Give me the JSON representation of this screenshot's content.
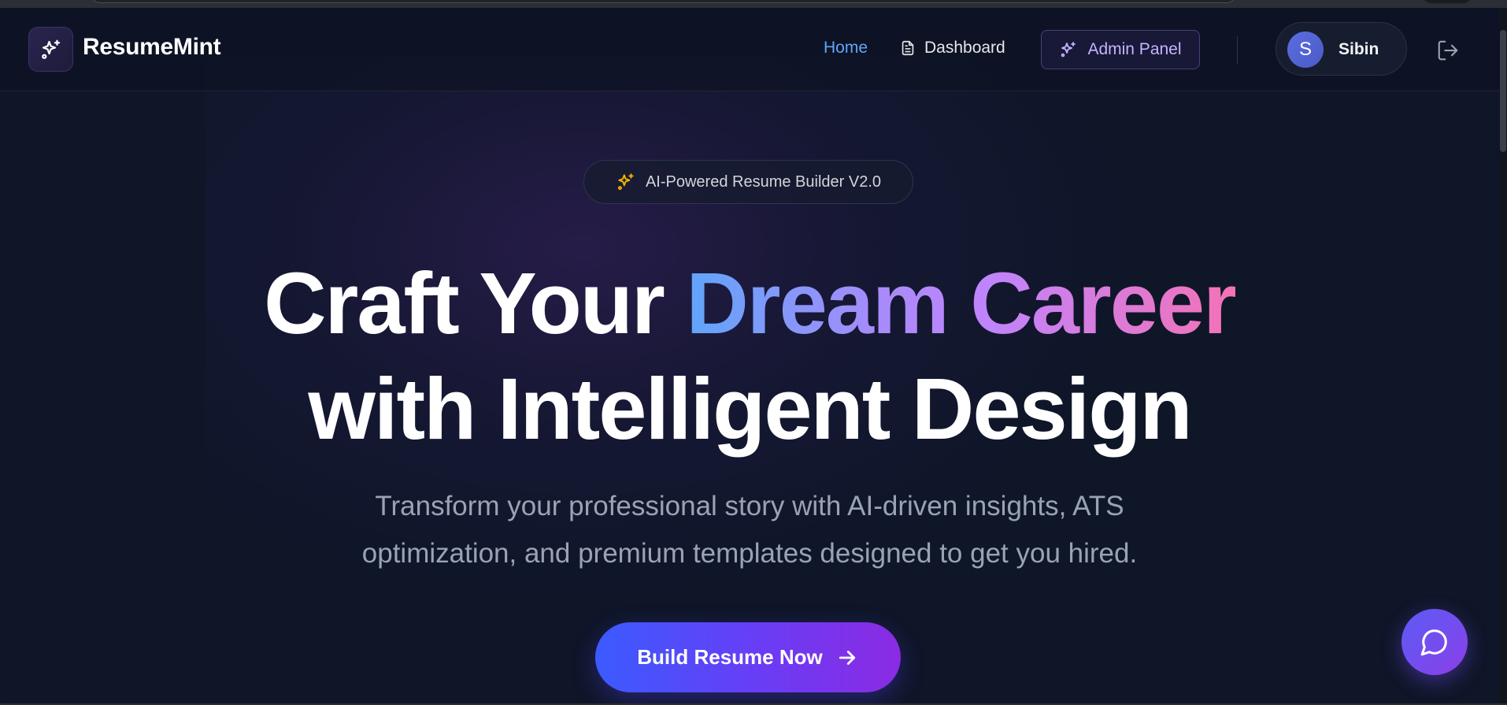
{
  "nav": {
    "brand": "ResumeMint",
    "links": [
      {
        "label": "Home",
        "active": true
      },
      {
        "label": "Dashboard",
        "icon": "document-icon"
      },
      {
        "label": "Admin Panel",
        "icon": "sparkles-icon"
      }
    ],
    "user": {
      "initial": "S",
      "name": "Sibin"
    },
    "logout_icon": "logout-icon"
  },
  "hero": {
    "badge": "AI-Powered Resume Builder V2.0",
    "headline": {
      "line1_plain": "Craft Your ",
      "line1_gradient": "Dream Career",
      "line2": "with Intelligent Design"
    },
    "subtitle": {
      "line1": "Transform your professional story with AI-driven insights, ATS",
      "line2": "optimization, and premium templates designed to get you hired."
    },
    "cta_label": "Build Resume Now"
  },
  "chat_fab_icon": "chat-bubble-icon",
  "colors": {
    "background": "#0f1628",
    "active_link": "#60a5fa",
    "admin_text": "#c4b5fd",
    "badge_icon": "#f5b301",
    "cta_start": "#3b5bff",
    "cta_end": "#8b2be2"
  }
}
